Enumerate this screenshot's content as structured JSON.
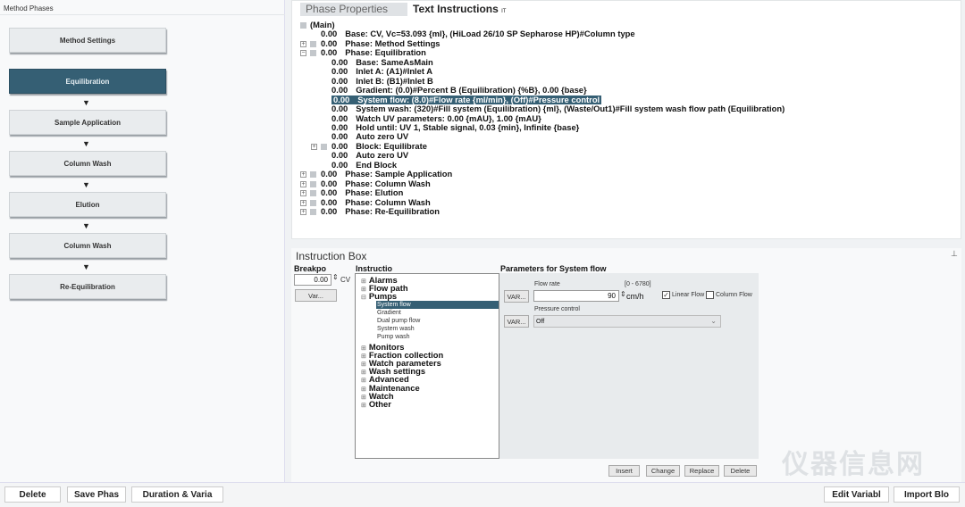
{
  "left": {
    "title": "Method Phases",
    "phases": [
      {
        "label": "Method Settings",
        "selected": false
      },
      {
        "label": "Equilibration",
        "selected": true
      },
      {
        "label": "Sample Application",
        "selected": false
      },
      {
        "label": "Column Wash",
        "selected": false
      },
      {
        "label": "Elution",
        "selected": false
      },
      {
        "label": "Column Wash",
        "selected": false
      },
      {
        "label": "Re-Equilibration",
        "selected": false
      }
    ],
    "arrow_icon": "down-triangle-icon"
  },
  "tabs": {
    "phase_properties": "Phase Properties",
    "text_instructions": "Text Instructions",
    "tab_icon": "IT"
  },
  "tree": [
    {
      "level": 0,
      "box": true,
      "value": "",
      "text": "(Main)"
    },
    {
      "level": 1,
      "value": "0.00",
      "text": "Base: CV, Vc=53.093 {ml}, (HiLoad 26/10 SP Sepharose HP)#Column type"
    },
    {
      "level": 1,
      "box": true,
      "exp": "+",
      "value": "0.00",
      "text": "Phase: Method Settings"
    },
    {
      "level": 1,
      "box": true,
      "exp": "-",
      "value": "0.00",
      "text": "Phase: Equilibration"
    },
    {
      "level": 2,
      "value": "0.00",
      "text": "Base: SameAsMain"
    },
    {
      "level": 2,
      "value": "0.00",
      "text": "Inlet A: (A1)#Inlet A"
    },
    {
      "level": 2,
      "value": "0.00",
      "text": "Inlet B: (B1)#Inlet B"
    },
    {
      "level": 2,
      "value": "0.00",
      "text": "Gradient: (0.0)#Percent B (Equilibration) {%B}, 0.00 {base}"
    },
    {
      "level": 2,
      "value": "0.00",
      "text": "System flow: (8.0)#Flow rate {ml/min}, (Off)#Pressure control",
      "selected": true
    },
    {
      "level": 2,
      "value": "0.00",
      "text": "System wash: (320)#Fill system (Equilibration) {ml}, (Waste/Out1)#Fill system wash flow path (Equilibration)"
    },
    {
      "level": 2,
      "value": "0.00",
      "text": "Watch UV parameters: 0.00 {mAU}, 1.00 {mAU}"
    },
    {
      "level": 2,
      "value": "0.00",
      "text": "Hold until: UV 1, Stable signal, 0.03 {min}, Infinite {base}"
    },
    {
      "level": 2,
      "value": "0.00",
      "text": "Auto zero UV"
    },
    {
      "level": 2,
      "box": true,
      "exp": "+",
      "value": "0.00",
      "text": "Block: Equilibrate"
    },
    {
      "level": 2,
      "value": "0.00",
      "text": "Auto zero UV"
    },
    {
      "level": 2,
      "value": "0.00",
      "text": "End  Block"
    },
    {
      "level": 1,
      "box": true,
      "exp": "+",
      "value": "0.00",
      "text": "Phase: Sample Application"
    },
    {
      "level": 1,
      "box": true,
      "exp": "+",
      "value": "0.00",
      "text": "Phase: Column Wash"
    },
    {
      "level": 1,
      "box": true,
      "exp": "+",
      "value": "0.00",
      "text": "Phase: Elution"
    },
    {
      "level": 1,
      "box": true,
      "exp": "+",
      "value": "0.00",
      "text": "Phase: Column Wash"
    },
    {
      "level": 1,
      "box": true,
      "exp": "+",
      "value": "0.00",
      "text": "Phase: Re-Equilibration"
    }
  ],
  "ibox": {
    "title": "Instruction Box",
    "pin_icon": "pin-icon",
    "breakpoint_label": "Breakpo",
    "breakpoint_value": "0.00",
    "breakpoint_unit": "CV",
    "var_button": "Var...",
    "instruction_label": "Instructio",
    "groups_top": [
      "Alarms",
      "Flow path",
      "Pumps"
    ],
    "pump_items": [
      {
        "label": "System flow",
        "selected": true
      },
      {
        "label": "Gradient"
      },
      {
        "label": "Dual pump flow"
      },
      {
        "label": "System wash"
      },
      {
        "label": "Pump wash"
      }
    ],
    "groups_bottom": [
      "Monitors",
      "Fraction collection",
      "Watch parameters",
      "Wash settings",
      "Advanced",
      "Maintenance",
      "Watch",
      "Other"
    ],
    "params_title": "Parameters for System flow",
    "flow_rate_label": "Flow rate",
    "flow_rate_range": "[0 - 6780]",
    "flow_rate_value": "90",
    "flow_rate_unit": "cm/h",
    "var_btn": "VAR...",
    "linear_flow": {
      "label": "Linear Flow",
      "checked": true
    },
    "column_flow": {
      "label": "Column Flow",
      "checked": false
    },
    "pressure_label": "Pressure control",
    "pressure_value": "Off",
    "actions": [
      "Insert",
      "Change",
      "Replace",
      "Delete"
    ]
  },
  "bottom": {
    "delete": "Delete",
    "save": "Save Phas",
    "duration": "Duration & Varia",
    "edit_var": "Edit Variabl",
    "import": "Import Blo"
  },
  "watermark": "仪器信息网"
}
